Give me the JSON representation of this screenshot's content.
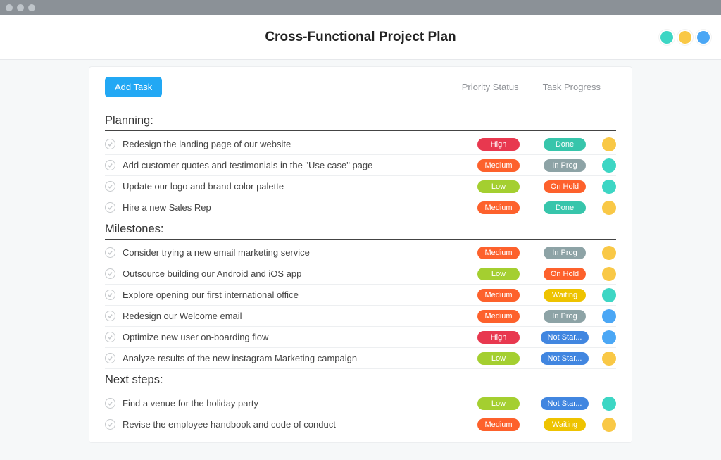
{
  "header": {
    "title": "Cross-Functional Project Plan"
  },
  "toolbar": {
    "add_task": "Add Task",
    "col_priority": "Priority Status",
    "col_progress": "Task Progress"
  },
  "priority_colors": {
    "High": "c-high",
    "Medium": "c-medium",
    "Low": "c-low"
  },
  "progress_colors": {
    "Done": "c-done",
    "In Prog": "c-inprog",
    "On Hold": "c-onhold",
    "Waiting": "c-waiting",
    "Not Star...": "c-notstar"
  },
  "sections": [
    {
      "title": "Planning:",
      "tasks": [
        {
          "title": "Redesign the landing page of our website",
          "priority": "High",
          "progress": "Done",
          "assignee": 0
        },
        {
          "title": "Add customer quotes and testimonials in the \"Use case\" page",
          "priority": "Medium",
          "progress": "In Prog",
          "assignee": 1
        },
        {
          "title": "Update our logo and brand color palette",
          "priority": "Low",
          "progress": "On Hold",
          "assignee": 1
        },
        {
          "title": "Hire a new Sales Rep",
          "priority": "Medium",
          "progress": "Done",
          "assignee": 0
        }
      ]
    },
    {
      "title": "Milestones:",
      "tasks": [
        {
          "title": "Consider trying a new email marketing service",
          "priority": "Medium",
          "progress": "In Prog",
          "assignee": 0
        },
        {
          "title": "Outsource building our Android and iOS app",
          "priority": "Low",
          "progress": "On Hold",
          "assignee": 0
        },
        {
          "title": "Explore opening our first international office",
          "priority": "Medium",
          "progress": "Waiting",
          "assignee": 1
        },
        {
          "title": "Redesign our Welcome email",
          "priority": "Medium",
          "progress": "In Prog",
          "assignee": 2
        },
        {
          "title": "Optimize new user on-boarding flow",
          "priority": "High",
          "progress": "Not Star...",
          "assignee": 2
        },
        {
          "title": "Analyze results of the new instagram Marketing campaign",
          "priority": "Low",
          "progress": "Not Star...",
          "assignee": 0
        }
      ]
    },
    {
      "title": "Next steps:",
      "tasks": [
        {
          "title": "Find a venue for the holiday party",
          "priority": "Low",
          "progress": "Not Star...",
          "assignee": 1
        },
        {
          "title": "Revise the employee handbook and code of conduct",
          "priority": "Medium",
          "progress": "Waiting",
          "assignee": 0
        }
      ]
    }
  ]
}
